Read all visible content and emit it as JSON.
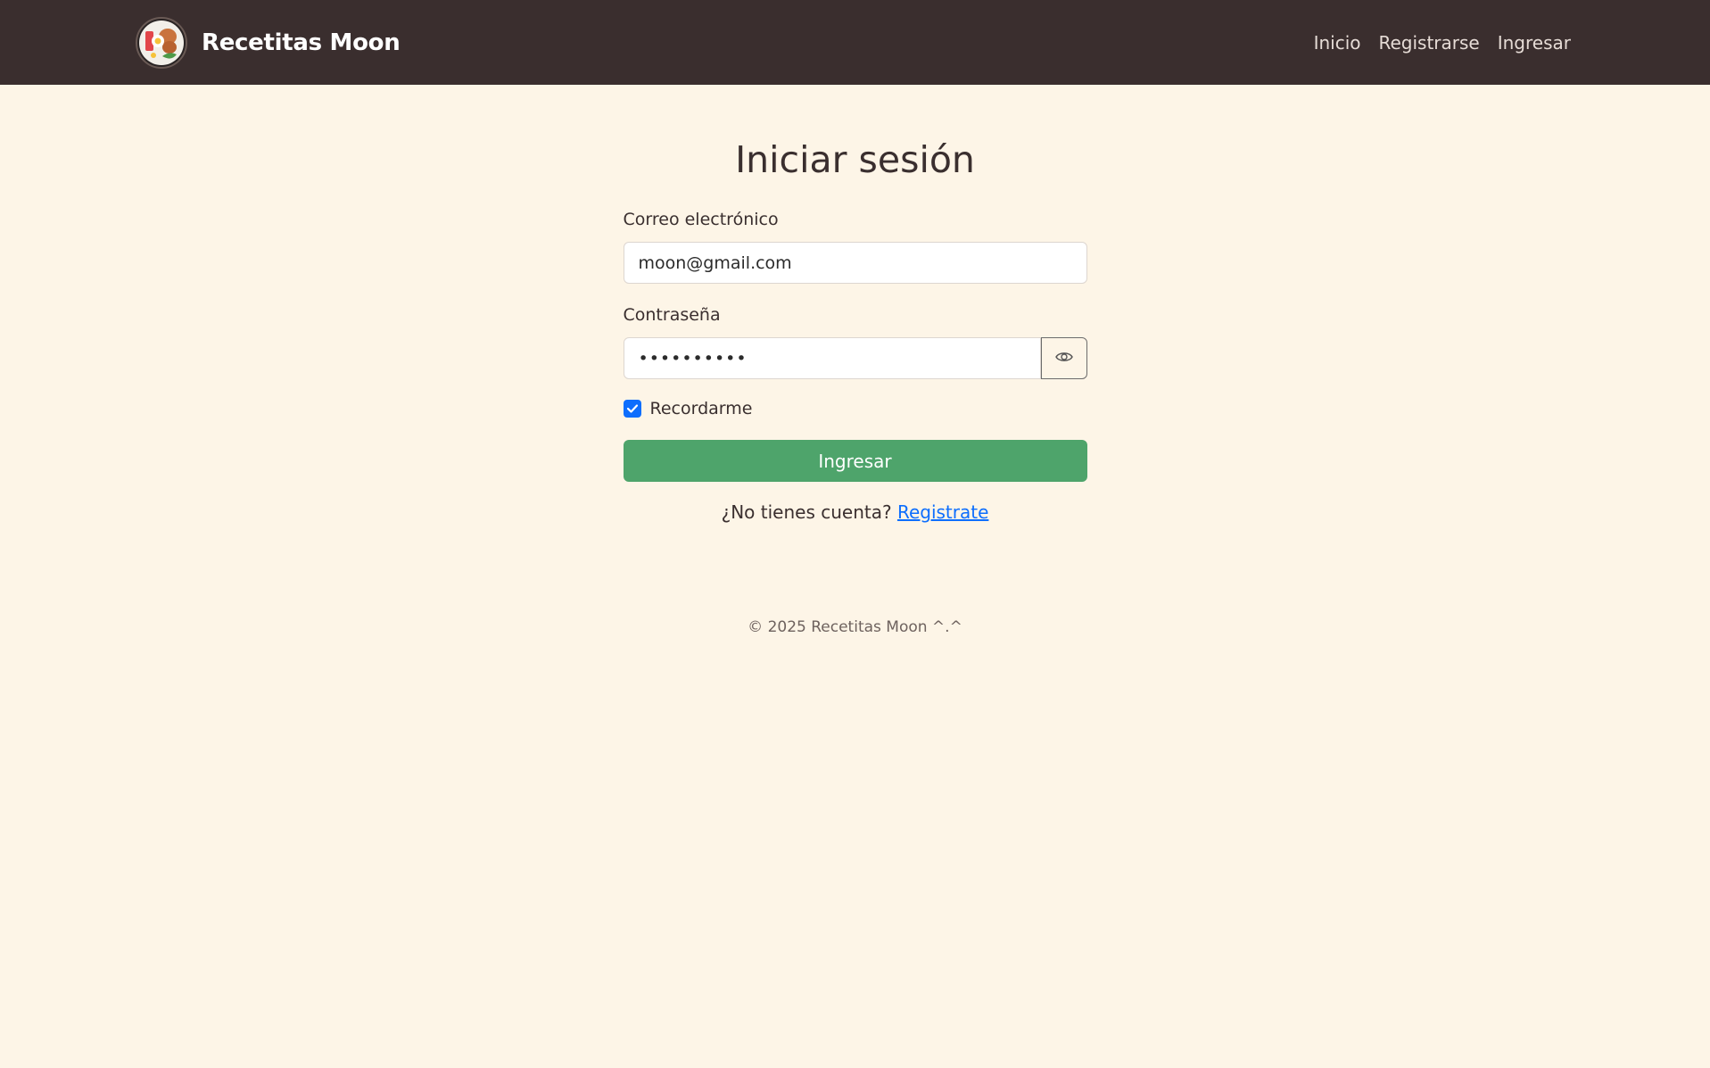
{
  "header": {
    "brand_name": "Recetitas Moon",
    "nav": [
      {
        "label": "Inicio"
      },
      {
        "label": "Registrarse"
      },
      {
        "label": "Ingresar"
      }
    ]
  },
  "login": {
    "title": "Iniciar sesión",
    "email_label": "Correo electrónico",
    "email_value": "moon@gmail.com",
    "password_label": "Contraseña",
    "password_value": "••••••••••",
    "remember_label": "Recordarme",
    "remember_checked": true,
    "submit_label": "Ingresar",
    "signup_prompt": "¿No tienes cuenta?",
    "signup_link": "Registrate"
  },
  "footer": {
    "text": "© 2025 Recetitas Moon ^.^"
  },
  "colors": {
    "navbar": "#3a2e2e",
    "background": "#fdf5e7",
    "submit_button": "#4ea46b",
    "link": "#0d6efd",
    "checkbox": "#0d6efd"
  },
  "icons": {
    "logo": "food-plate-logo",
    "password_toggle": "eye-icon",
    "checkbox": "checkmark-icon"
  }
}
